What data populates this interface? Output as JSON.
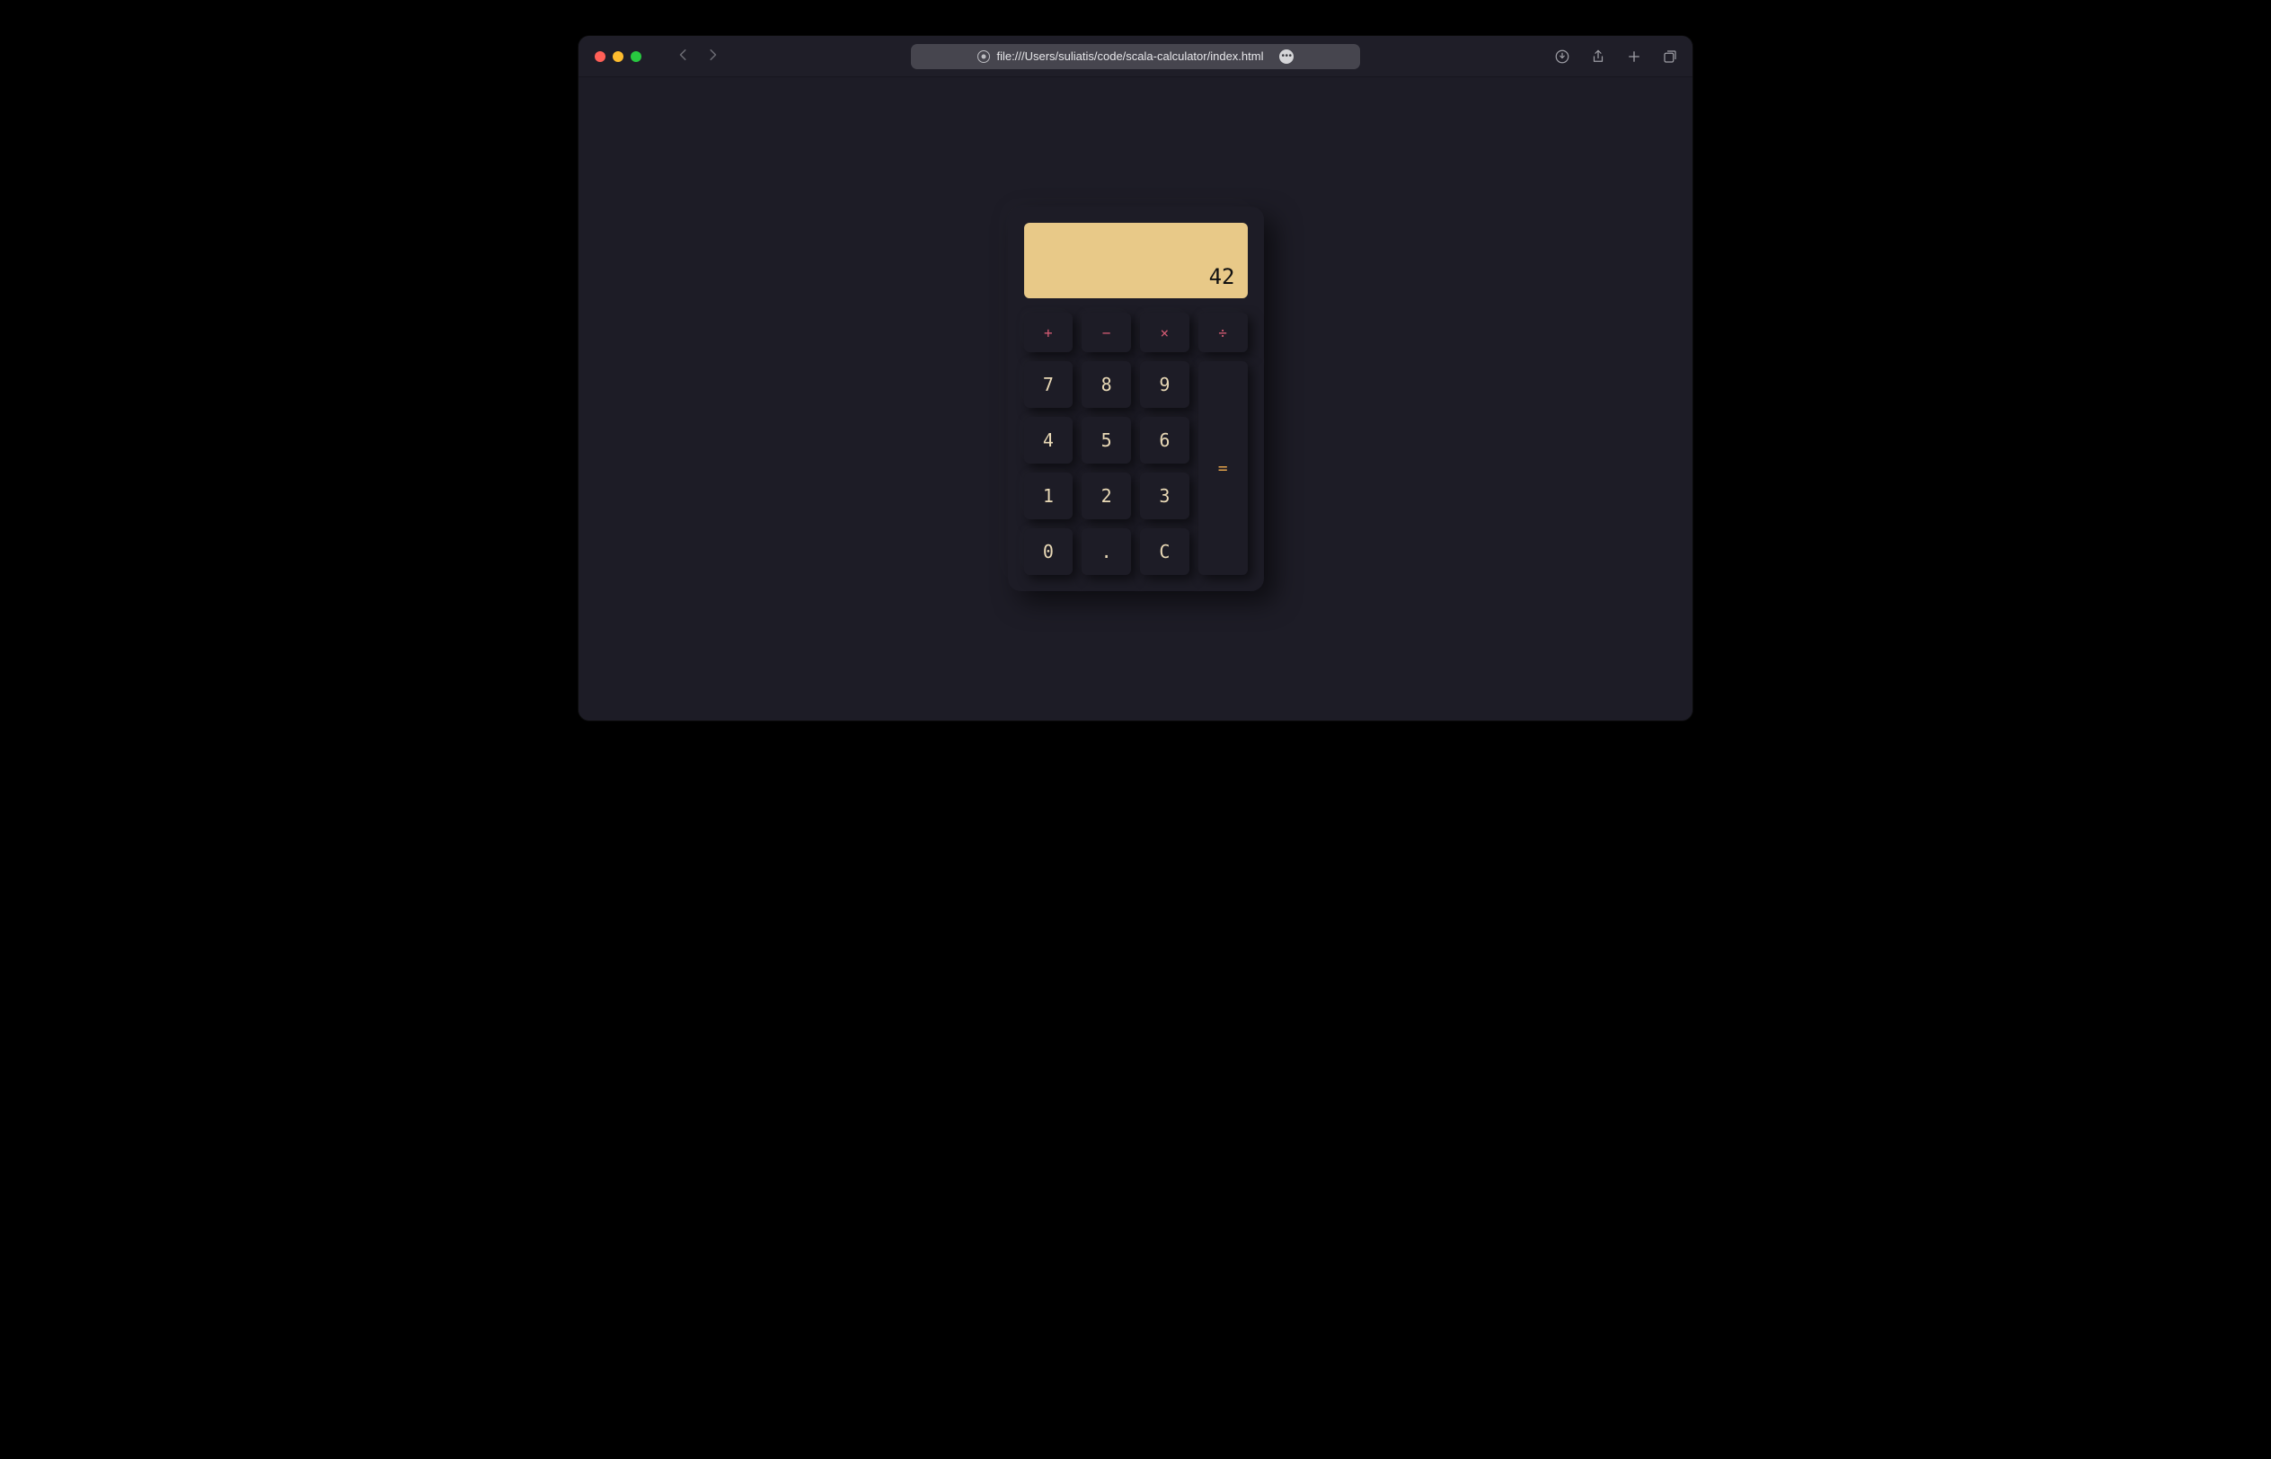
{
  "browser": {
    "url": "file:///Users/suliatis/code/scala-calculator/index.html"
  },
  "calculator": {
    "display_value": "42",
    "operators": {
      "add": "+",
      "subtract": "−",
      "multiply": "×",
      "divide": "÷"
    },
    "digits": {
      "d7": "7",
      "d8": "8",
      "d9": "9",
      "d4": "4",
      "d5": "5",
      "d6": "6",
      "d1": "1",
      "d2": "2",
      "d3": "3",
      "d0": "0"
    },
    "decimal": ".",
    "clear": "C",
    "equals": "="
  }
}
